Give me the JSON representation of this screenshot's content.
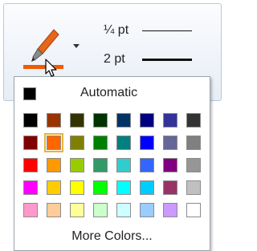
{
  "ribbon": {
    "pen_button": {
      "icon": "pen-icon",
      "color": "#f05a00"
    },
    "weights": [
      {
        "label": "¼ pt",
        "line": "thin"
      },
      {
        "label": "2 pt",
        "line": "thick"
      }
    ]
  },
  "color_picker": {
    "automatic": {
      "label": "Automatic",
      "color": "#000000"
    },
    "rows": [
      [
        "#000000",
        "#993300",
        "#333300",
        "#003300",
        "#003366",
        "#000080",
        "#333399",
        "#333333"
      ],
      [
        "#800000",
        "#ff6600",
        "#808000",
        "#008000",
        "#008080",
        "#0000ff",
        "#666699",
        "#808080"
      ],
      [
        "#ff0000",
        "#ff9900",
        "#99cc00",
        "#339966",
        "#33cccc",
        "#3366ff",
        "#800080",
        "#969696"
      ],
      [
        "#ff00ff",
        "#ffcc00",
        "#ffff00",
        "#00ff00",
        "#00ffff",
        "#00ccff",
        "#993366",
        "#c0c0c0"
      ],
      [
        "#ff99cc",
        "#ffcc99",
        "#ffff99",
        "#ccffcc",
        "#ccffff",
        "#99ccff",
        "#cc99ff",
        "#ffffff"
      ]
    ],
    "selected_color": "#ff6600",
    "more_label": "More Colors..."
  }
}
